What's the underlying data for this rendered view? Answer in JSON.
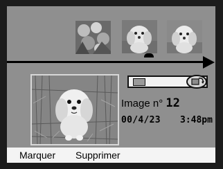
{
  "timeline": {
    "thumbnails": [
      {
        "subject": "flowers-photo-thumbnail"
      },
      {
        "subject": "dog-photo-thumbnail-selected"
      },
      {
        "subject": "dog-photo-thumbnail"
      }
    ]
  },
  "preview": {
    "subject": "shih-tzu-dog-in-grass"
  },
  "slider": {
    "icon_left": "frame-icon",
    "icon_right": "rotate-icon"
  },
  "image_info": {
    "label": "Image n° ",
    "number": "12",
    "date": "00/4/23",
    "time": "3:48pm"
  },
  "menu": {
    "mark": "Marquer",
    "delete": "Supprimer"
  }
}
